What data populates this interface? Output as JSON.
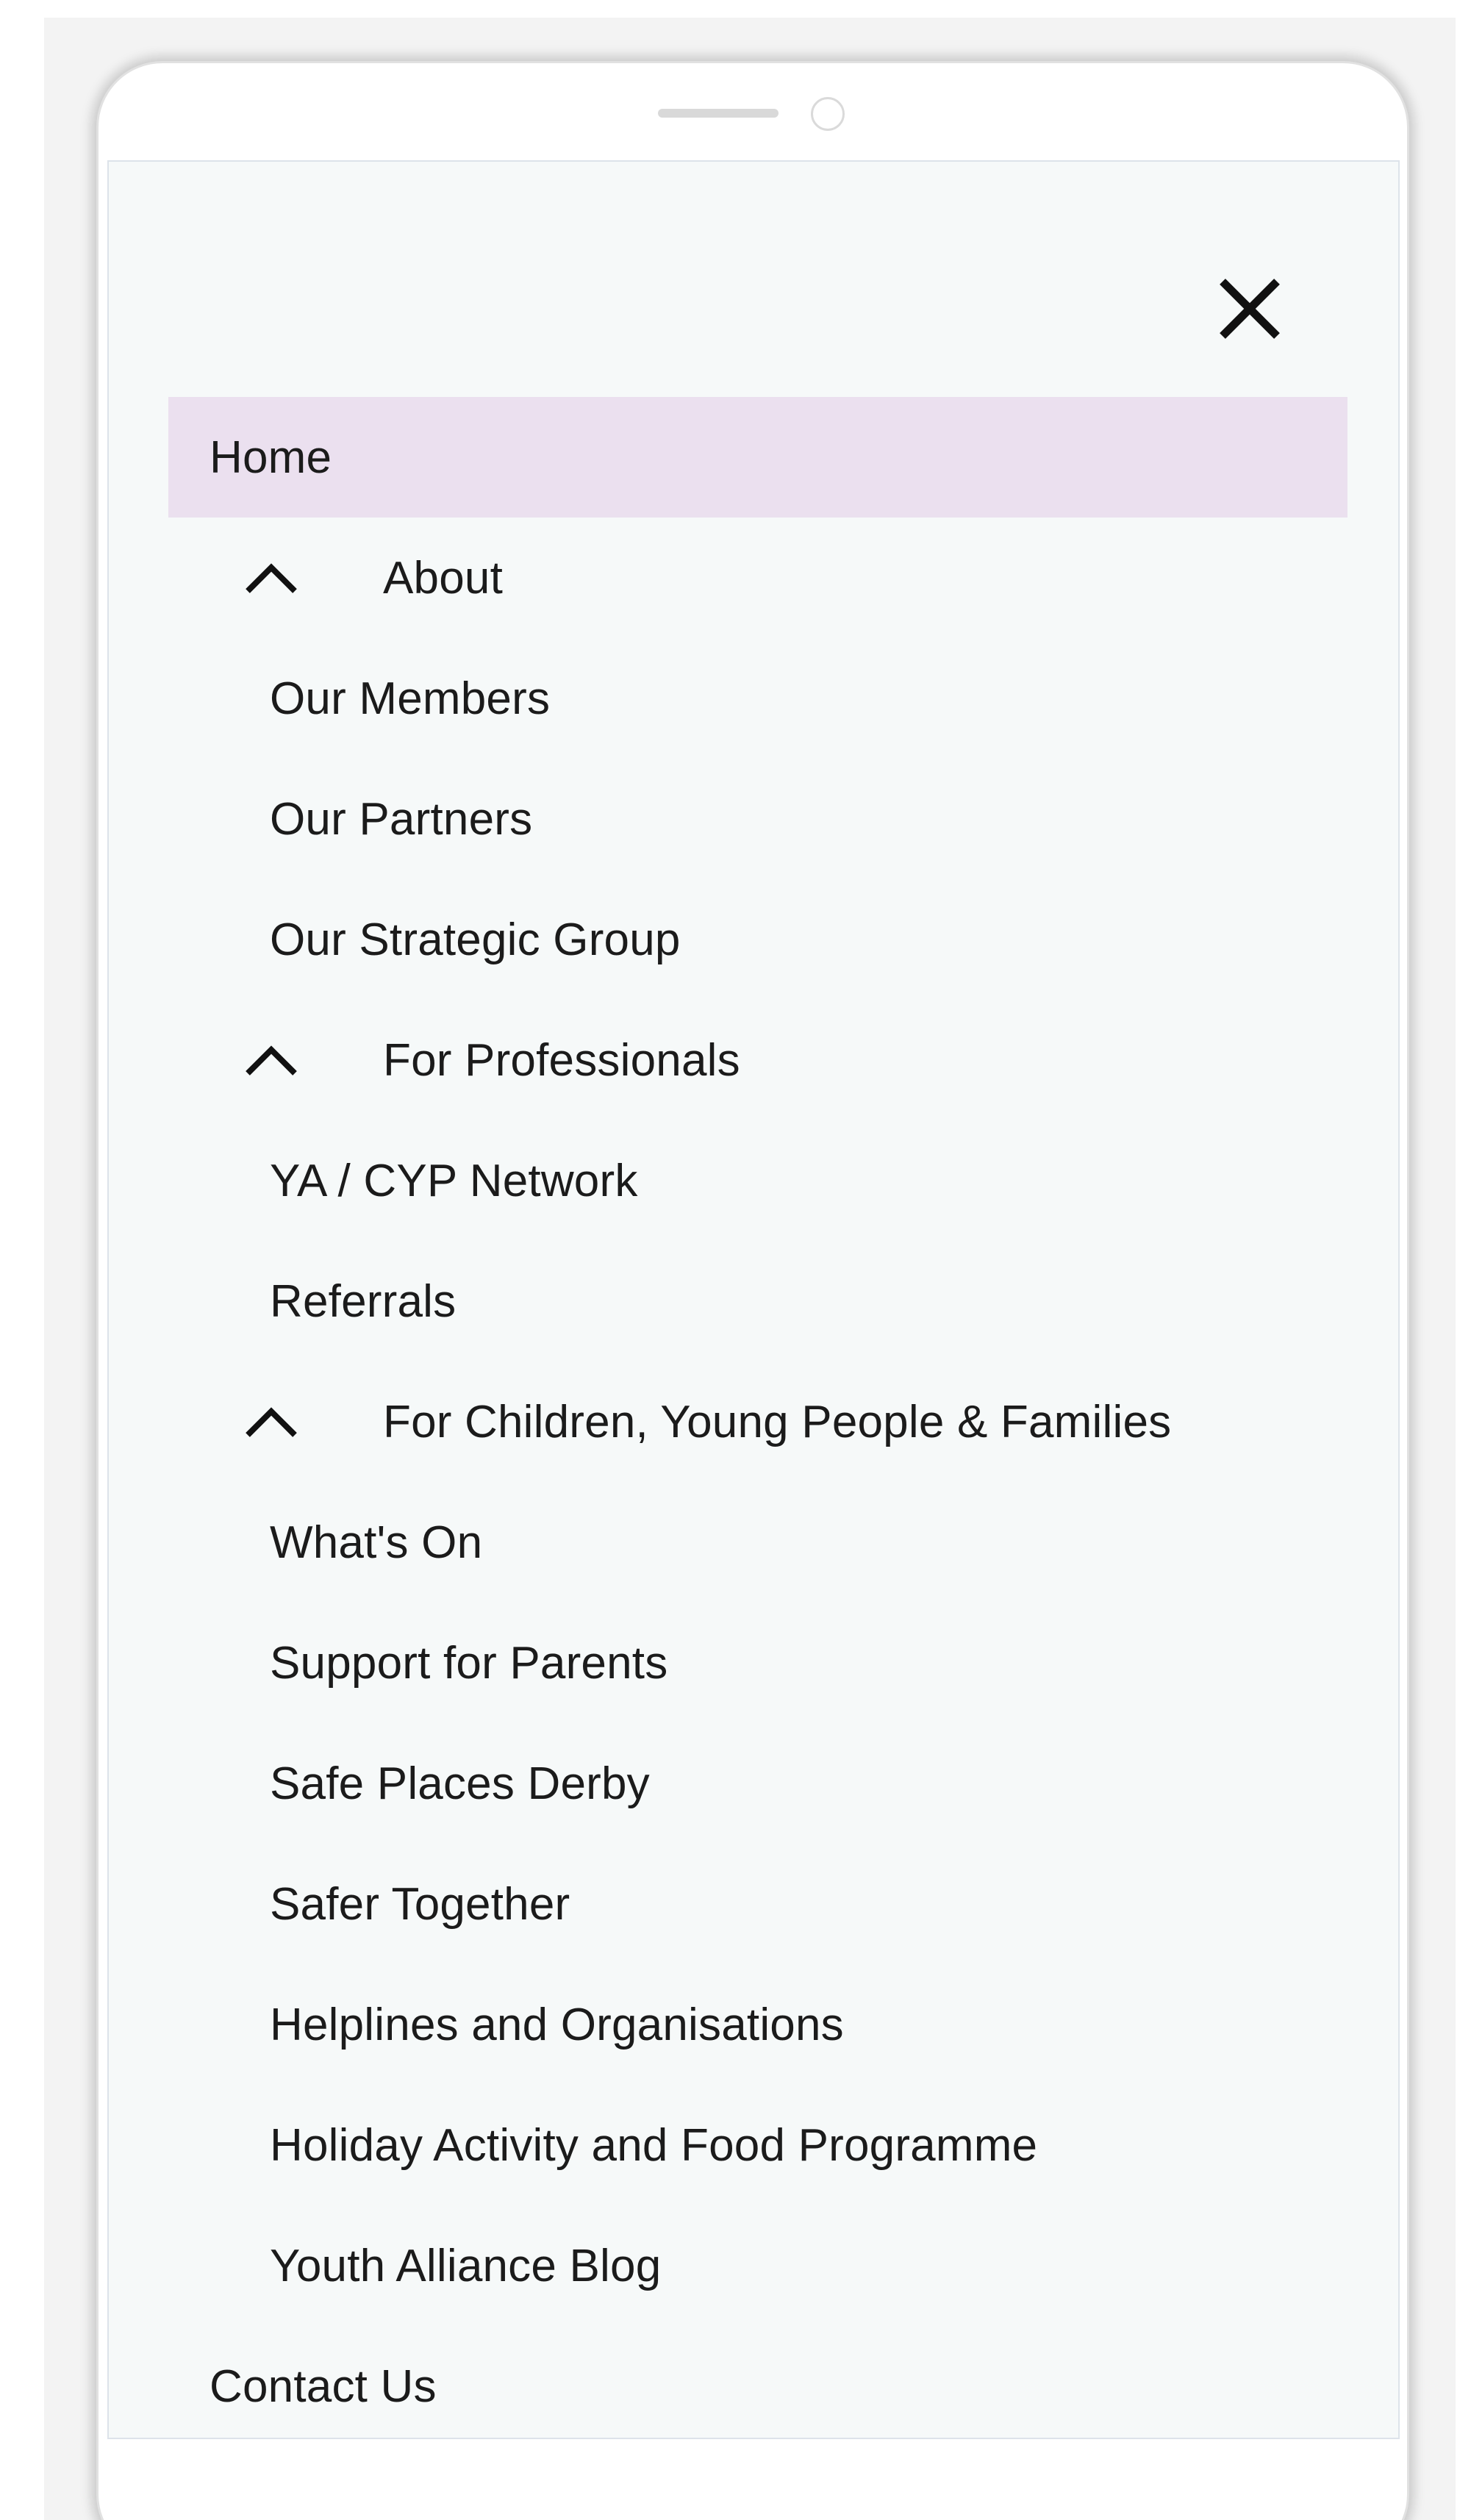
{
  "menu": {
    "items": [
      {
        "label": "Home",
        "kind": "top",
        "active": true
      },
      {
        "label": "About",
        "kind": "section",
        "icon": "chevron-up-icon"
      },
      {
        "label": "Our Members",
        "kind": "sub"
      },
      {
        "label": "Our Partners",
        "kind": "sub"
      },
      {
        "label": "Our Strategic Group",
        "kind": "sub"
      },
      {
        "label": "For Professionals",
        "kind": "section",
        "icon": "chevron-up-icon"
      },
      {
        "label": "YA / CYP Network",
        "kind": "sub"
      },
      {
        "label": "Referrals",
        "kind": "sub"
      },
      {
        "label": "For Children, Young People & Families",
        "kind": "section",
        "icon": "chevron-up-icon"
      },
      {
        "label": "What's On",
        "kind": "sub"
      },
      {
        "label": "Support for Parents",
        "kind": "sub"
      },
      {
        "label": "Safe Places Derby",
        "kind": "sub"
      },
      {
        "label": "Safer Together",
        "kind": "sub"
      },
      {
        "label": "Helplines and Organisations",
        "kind": "sub"
      },
      {
        "label": "Holiday Activity and Food Programme",
        "kind": "sub"
      },
      {
        "label": "Youth Alliance Blog",
        "kind": "sub"
      },
      {
        "label": "Contact Us",
        "kind": "top"
      }
    ]
  },
  "icons": {
    "close": "close-icon"
  },
  "colors": {
    "active_background": "#ebe0ef",
    "screen_background": "#f6f9f9",
    "text": "#1b1b1b"
  }
}
